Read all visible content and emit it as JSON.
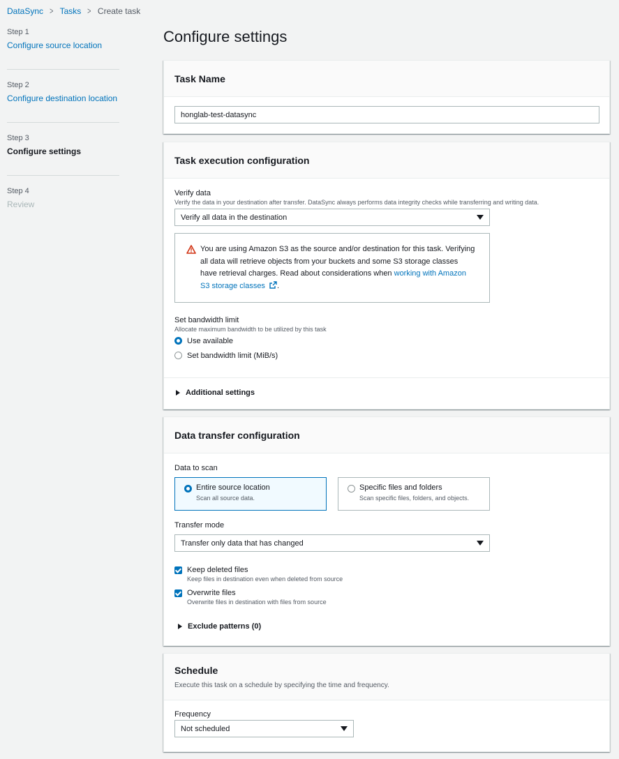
{
  "breadcrumb": [
    "DataSync",
    "Tasks",
    "Create task"
  ],
  "steps": [
    {
      "num": "Step 1",
      "title": "Configure source location"
    },
    {
      "num": "Step 2",
      "title": "Configure destination location"
    },
    {
      "num": "Step 3",
      "title": "Configure settings"
    },
    {
      "num": "Step 4",
      "title": "Review"
    }
  ],
  "page_title": "Configure settings",
  "task_name": {
    "title": "Task Name",
    "value": "honglab-test-datasync"
  },
  "task_execution": {
    "title": "Task execution configuration",
    "verify_label": "Verify data",
    "verify_desc": "Verify the data in your destination after transfer. DataSync always performs data integrity checks while transferring and writing data.",
    "verify_value": "Verify all data in the destination",
    "alert_text": "You are using Amazon S3 as the source and/or destination for this task. Verifying all data will retrieve objects from your buckets and some S3 storage classes have retrieval charges. Read about considerations when ",
    "alert_link": "working with Amazon S3 storage classes",
    "alert_end": ".",
    "bandwidth_label": "Set bandwidth limit",
    "bandwidth_desc": "Allocate maximum bandwidth to be utilized by this task",
    "bandwidth_options": [
      "Use available",
      "Set bandwidth limit (MiB/s)"
    ],
    "additional_settings": "Additional settings"
  },
  "data_transfer": {
    "title": "Data transfer configuration",
    "scan_label": "Data to scan",
    "tile1_title": "Entire source location",
    "tile1_desc": "Scan all source data.",
    "tile2_title": "Specific files and folders",
    "tile2_desc": "Scan specific files, folders, and objects.",
    "mode_label": "Transfer mode",
    "mode_value": "Transfer only data that has changed",
    "keep_label": "Keep deleted files",
    "keep_desc": "Keep files in destination even when deleted from source",
    "overwrite_label": "Overwrite files",
    "overwrite_desc": "Overwrite files in destination with files from source",
    "exclude": "Exclude patterns (0)"
  },
  "schedule": {
    "title": "Schedule",
    "desc": "Execute this task on a schedule by specifying the time and frequency.",
    "frequency_label": "Frequency",
    "frequency_value": "Not scheduled"
  },
  "colors": {
    "accent": "#0073bb",
    "warning": "#d13212"
  }
}
